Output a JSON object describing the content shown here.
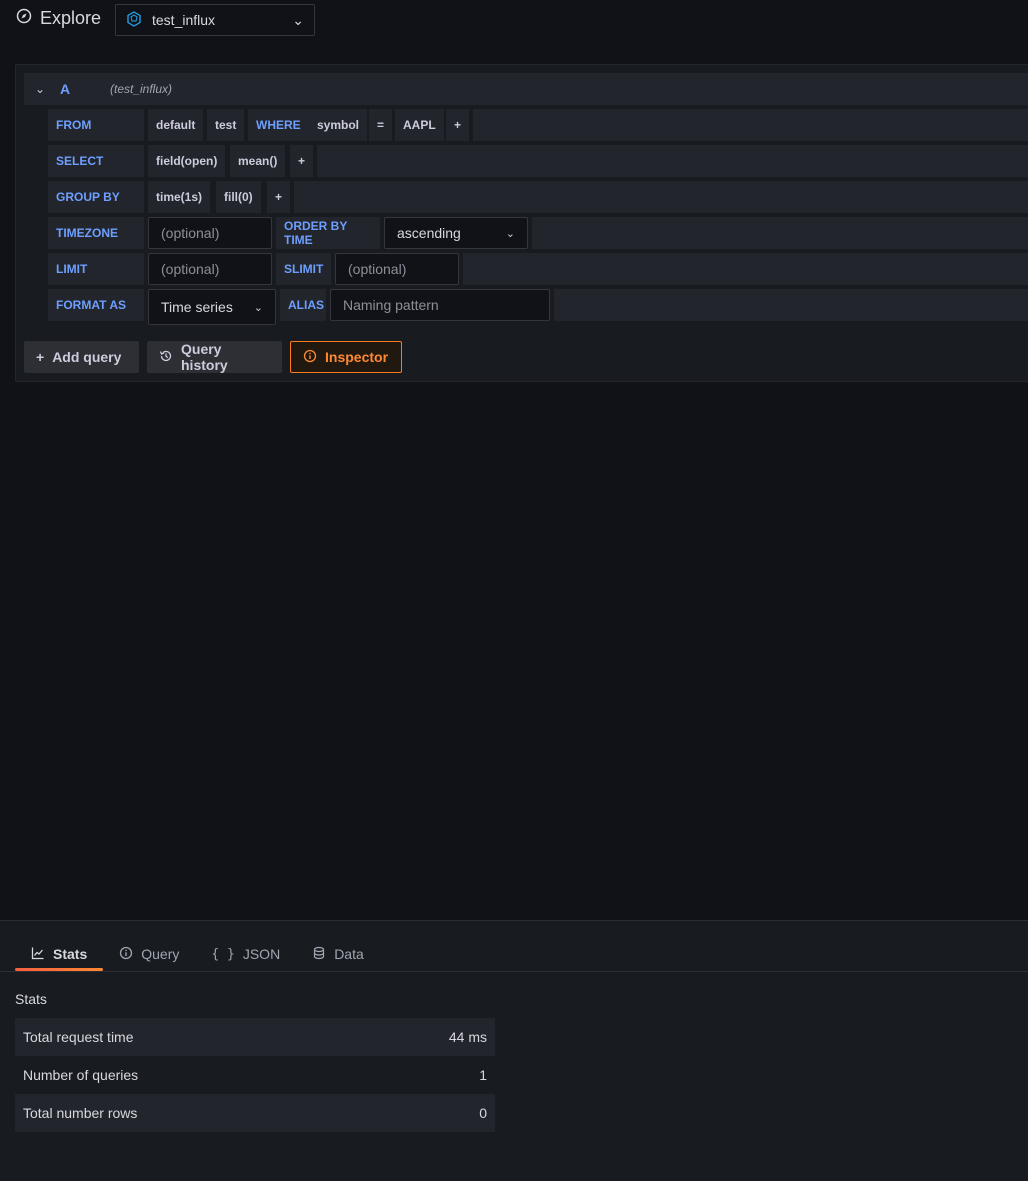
{
  "header": {
    "title": "Explore",
    "datasource": "test_influx"
  },
  "query": {
    "ref_id": "A",
    "datasource_hint": "(test_influx)",
    "from": {
      "label": "FROM",
      "policy": "default",
      "measurement": "test",
      "where_label": "WHERE",
      "tag": "symbol",
      "operator": "=",
      "value": "AAPL",
      "add": "+"
    },
    "select": {
      "label": "SELECT",
      "field": "field(open)",
      "agg": "mean()",
      "add": "+"
    },
    "group_by": {
      "label": "GROUP BY",
      "time": "time(1s)",
      "fill": "fill(0)",
      "add": "+"
    },
    "timezone": {
      "label": "TIMEZONE",
      "placeholder": "(optional)"
    },
    "order_by_time": {
      "label": "ORDER BY TIME",
      "value": "ascending"
    },
    "limit": {
      "label": "LIMIT",
      "placeholder": "(optional)"
    },
    "slimit": {
      "label": "SLIMIT",
      "placeholder": "(optional)"
    },
    "format_as": {
      "label": "FORMAT AS",
      "value": "Time series"
    },
    "alias": {
      "label": "ALIAS",
      "placeholder": "Naming pattern"
    }
  },
  "actions": {
    "add_query": "Add query",
    "query_history": "Query history",
    "inspector": "Inspector"
  },
  "inspector": {
    "tabs": [
      {
        "label": "Stats",
        "icon": "chart-line-icon"
      },
      {
        "label": "Query",
        "icon": "info-circle-icon"
      },
      {
        "label": "JSON",
        "icon": "braces-icon"
      },
      {
        "label": "Data",
        "icon": "database-icon"
      }
    ],
    "stats_title": "Stats",
    "stats": [
      {
        "label": "Total request time",
        "value": "44 ms"
      },
      {
        "label": "Number of queries",
        "value": "1"
      },
      {
        "label": "Total number rows",
        "value": "0"
      }
    ]
  },
  "colors": {
    "accent_blue": "#6e9fff",
    "accent_orange": "#ff8833",
    "background": "#111217"
  }
}
